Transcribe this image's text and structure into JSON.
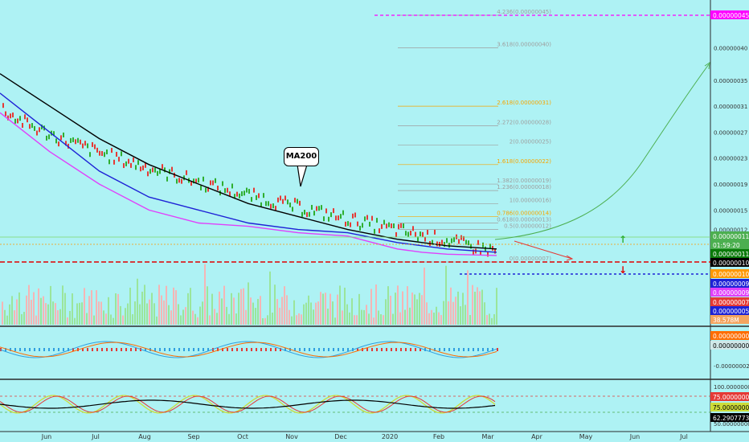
{
  "chart_data": {
    "type": "line",
    "ma_annotation": "MA200",
    "x_tick_labels": [
      "Jun",
      "Jul",
      "Aug",
      "Sep",
      "Oct",
      "Nov",
      "Dec",
      "2020",
      "Feb",
      "Mar",
      "Apr",
      "May",
      "Jun",
      "Jul"
    ],
    "price_axis_ticks": [
      "0.00000040",
      "0.00000035",
      "0.00000031",
      "0.00000027",
      "0.00000023",
      "0.00000019",
      "0.00000015",
      "0.00000012"
    ],
    "fib_levels": [
      {
        "label": "4.236(0.00000045)",
        "value": 4.5e-07,
        "color": "#9e9e9e"
      },
      {
        "label": "3.618(0.00000040)",
        "value": 4e-07,
        "color": "#9e9e9e"
      },
      {
        "label": "2.618(0.00000031)",
        "value": 3.1e-07,
        "color": "#f7a600"
      },
      {
        "label": "2.272(0.00000028)",
        "value": 2.8e-07,
        "color": "#9e9e9e"
      },
      {
        "label": "2(0.00000025)",
        "value": 2.5e-07,
        "color": "#9e9e9e"
      },
      {
        "label": "1.618(0.00000022)",
        "value": 2.2e-07,
        "color": "#f7a600"
      },
      {
        "label": "1.382(0.00000019)",
        "value": 1.9e-07,
        "color": "#9e9e9e"
      },
      {
        "label": "1.236(0.00000018)",
        "value": 1.8e-07,
        "color": "#9e9e9e"
      },
      {
        "label": "1(0.00000016)",
        "value": 1.6e-07,
        "color": "#9e9e9e"
      },
      {
        "label": "0.786(0.00000014)",
        "value": 1.4e-07,
        "color": "#f7a600"
      },
      {
        "label": "0.618(0.00000013)",
        "value": 1.3e-07,
        "color": "#9e9e9e"
      },
      {
        "label": "0.5(0.00000012)",
        "value": 1.2e-07,
        "color": "#9e9e9e"
      },
      {
        "label": "0(0.00000007)",
        "value": 7e-08,
        "color": "#9e9e9e"
      }
    ],
    "price_badges": [
      {
        "text": "0.00000045",
        "color": "#ff00ff"
      },
      {
        "text": "0.00000011",
        "color": "#4caf50"
      },
      {
        "text": "01:59:20",
        "color": "#4caf50"
      },
      {
        "text": "0.00000011",
        "color": "#0a7a0a"
      },
      {
        "text": "0.00000010",
        "color": "#000000"
      },
      {
        "text": "0.00000010",
        "color": "#ff9800"
      },
      {
        "text": "0.00000009",
        "color": "#1e22d6"
      },
      {
        "text": "0.00000009",
        "color": "#e040fb"
      },
      {
        "text": "0.00000007",
        "color": "#e53935"
      },
      {
        "text": "0.00000005",
        "color": "#1e22d6"
      },
      {
        "text": "38.578M",
        "color": "#f4a460"
      }
    ],
    "macd_badges": [
      {
        "text": "0.00000000",
        "color": "#ff6d00"
      },
      {
        "text": "0.00000000",
        "color": "#d0e8e8"
      }
    ],
    "macd_axis_label": "-0.00000002",
    "stoch_badges": [
      {
        "text": "75.00000000",
        "color": "#e53935"
      },
      {
        "text": "75.00000000",
        "color": "#cddc39"
      },
      {
        "text": "62.29077739",
        "color": "#000000"
      }
    ],
    "stoch_axis_ticks": [
      "100.00000000",
      "50.00000000"
    ],
    "series": [
      {
        "name": "MA200",
        "color": "#000000",
        "x": [
          0,
          0.1,
          0.2,
          0.3,
          0.4,
          0.5,
          0.6,
          0.7,
          0.8,
          0.85,
          0.9,
          1
        ],
        "y": [
          3.6e-07,
          3.1e-07,
          2.6e-07,
          2.2e-07,
          1.9e-07,
          1.6e-07,
          1.4e-07,
          1.2e-07,
          1.05e-07,
          1e-07,
          9.5e-08,
          9e-08
        ]
      },
      {
        "name": "",
        "color": "#1e22d6",
        "x": [
          0,
          0.1,
          0.2,
          0.3,
          0.4,
          0.5,
          0.6,
          0.7,
          0.8,
          0.85,
          0.9,
          1
        ],
        "y": [
          3.3e-07,
          2.7e-07,
          2.1e-07,
          1.7e-07,
          1.5e-07,
          1.3e-07,
          1.2e-07,
          1.15e-07,
          1e-07,
          9.5e-08,
          9e-08,
          8.5e-08
        ]
      },
      {
        "name": "",
        "color": "#e040fb",
        "x": [
          0,
          0.1,
          0.2,
          0.3,
          0.4,
          0.5,
          0.6,
          0.7,
          0.8,
          0.85,
          0.9,
          1
        ],
        "y": [
          3e-07,
          2.4e-07,
          1.9e-07,
          1.5e-07,
          1.3e-07,
          1.25e-07,
          1.15e-07,
          1.1e-07,
          9e-08,
          8.5e-08,
          8.2e-08,
          8e-08
        ]
      }
    ]
  }
}
